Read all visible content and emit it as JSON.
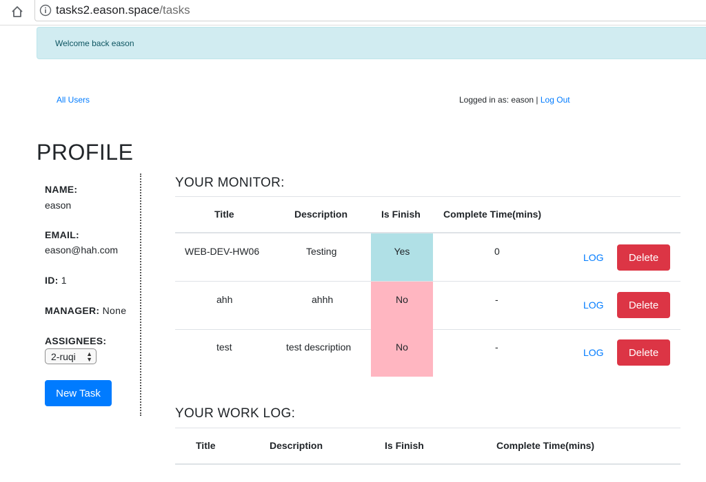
{
  "browser": {
    "url_host": "tasks2.eason.space",
    "url_path": "/tasks"
  },
  "alert": {
    "text": "Welcome back eason"
  },
  "nav": {
    "all_users": "All Users",
    "logged_in_prefix": "Logged in as: eason | ",
    "log_out": "Log Out"
  },
  "profile": {
    "title": "PROFILE",
    "name_label": "NAME:",
    "name_value": "eason",
    "email_label": "EMAIL:",
    "email_value": "eason@hah.com",
    "id_label": "ID:",
    "id_value": "1",
    "manager_label": "MANAGER:",
    "manager_value": "None",
    "assignees_label": "ASSIGNEES:",
    "assignee_selected": "2-ruqi",
    "new_task": "New Task"
  },
  "monitor": {
    "title": "YOUR MONITOR:",
    "headers": [
      "Title",
      "Description",
      "Is Finish",
      "Complete Time(mins)"
    ],
    "rows": [
      {
        "title": "WEB-DEV-HW06",
        "description": "Testing",
        "is_finish": "Yes",
        "complete_time": "0",
        "log": "LOG",
        "delete": "Delete"
      },
      {
        "title": "ahh",
        "description": "ahhh",
        "is_finish": "No",
        "complete_time": "-",
        "log": "LOG",
        "delete": "Delete"
      },
      {
        "title": "test",
        "description": "test description",
        "is_finish": "No",
        "complete_time": "-",
        "log": "LOG",
        "delete": "Delete"
      }
    ]
  },
  "worklog": {
    "title": "YOUR WORK LOG:",
    "headers": [
      "Title",
      "Description",
      "Is Finish",
      "Complete Time(mins)"
    ]
  },
  "colors": {
    "primary": "#007bff",
    "danger": "#dc3545",
    "alert_bg": "#d1ecf1",
    "finish_yes": "#b0e0e6",
    "finish_no": "#ffb6c1"
  }
}
